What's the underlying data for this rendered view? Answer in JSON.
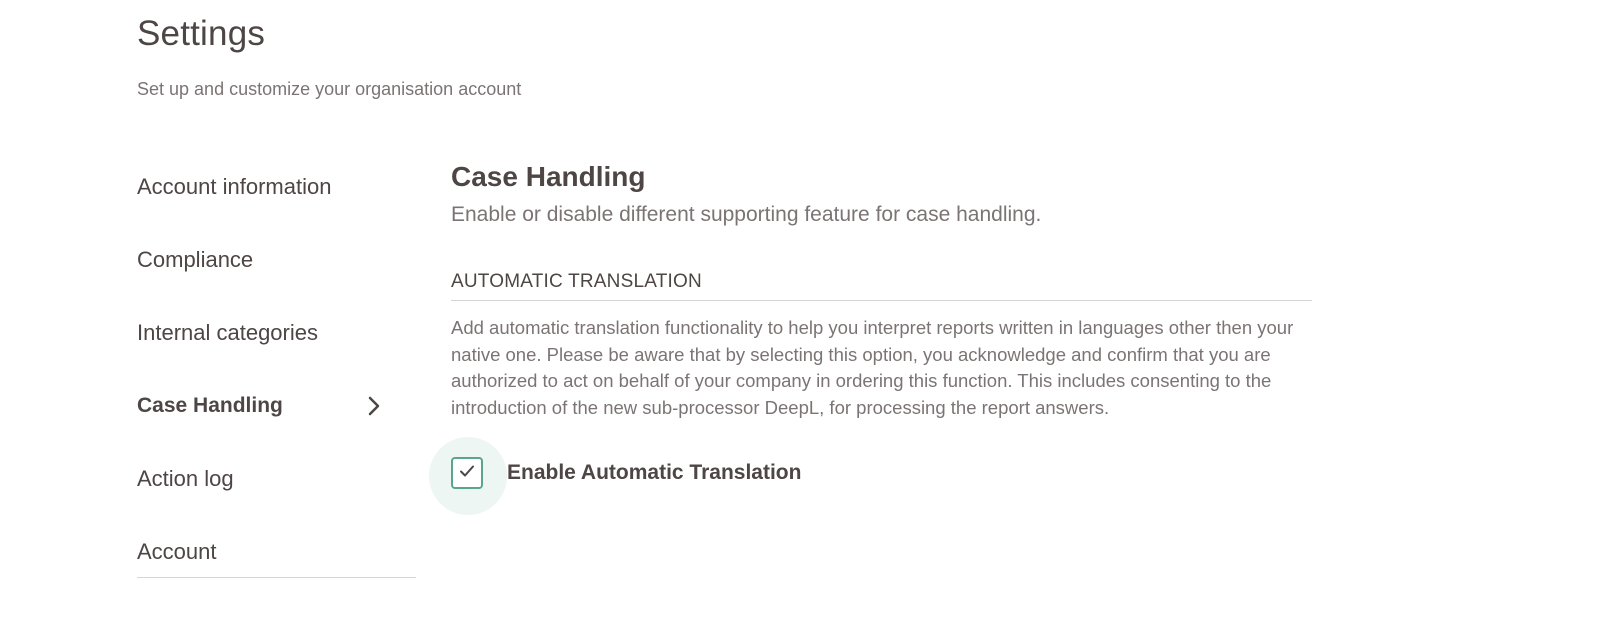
{
  "header": {
    "title": "Settings",
    "subtitle": "Set up and customize your organisation account"
  },
  "sidebar": {
    "items": [
      {
        "label": "Account information",
        "active": false
      },
      {
        "label": "Compliance",
        "active": false
      },
      {
        "label": "Internal categories",
        "active": false
      },
      {
        "label": "Case Handling",
        "active": true
      },
      {
        "label": "Action log",
        "active": false
      },
      {
        "label": "Account",
        "active": false
      }
    ],
    "active_icon": "chevron-right-icon"
  },
  "main": {
    "title": "Case Handling",
    "description": "Enable or disable different supporting feature for case handling.",
    "automatic_translation": {
      "header": "AUTOMATIC TRANSLATION",
      "text": "Add automatic translation functionality to help you interpret reports written in languages other then your native one. Please be aware that by selecting this option, you acknowledge and confirm that you are authorized to act on behalf of your company in ordering this function. This includes consenting to the introduction of the new sub-processor DeepL, for processing the report answers.",
      "checkbox_label": "Enable Automatic Translation",
      "checked": true,
      "checkbox_icon": "check-icon"
    }
  },
  "colors": {
    "text_primary": "#4e4545",
    "text_secondary": "#7c7474",
    "accent": "#5aa68a",
    "accent_halo": "#edf6f2",
    "divider": "#d9d4d4"
  }
}
